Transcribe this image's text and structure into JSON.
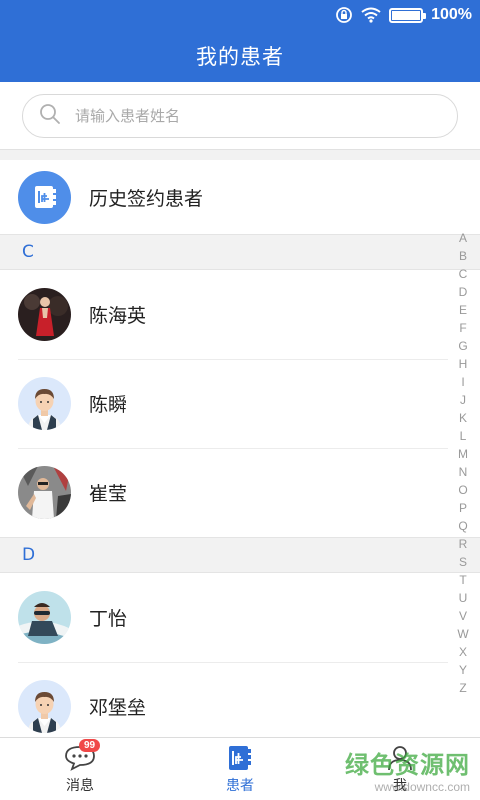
{
  "status_bar": {
    "battery_percent": "100%",
    "battery_level": 1.0,
    "icons": [
      "rotation-lock-icon",
      "wifi-icon",
      "battery-icon"
    ]
  },
  "header": {
    "title": "我的患者"
  },
  "search": {
    "placeholder": "请输入患者姓名",
    "value": ""
  },
  "history": {
    "label": "历史签约患者",
    "icon": "patient-record-icon"
  },
  "sections": [
    {
      "letter": "C",
      "patients": [
        "陈海英",
        "陈瞬",
        "崔莹"
      ]
    },
    {
      "letter": "D",
      "patients": [
        "丁怡",
        "邓堡垒"
      ]
    }
  ],
  "index_letters": [
    "A",
    "B",
    "C",
    "D",
    "E",
    "F",
    "G",
    "H",
    "I",
    "J",
    "K",
    "L",
    "M",
    "N",
    "O",
    "P",
    "Q",
    "R",
    "S",
    "T",
    "U",
    "V",
    "W",
    "X",
    "Y",
    "Z"
  ],
  "tabs": [
    {
      "label": "消息",
      "badge": "99",
      "icon": "chat-bubble-icon",
      "active": false
    },
    {
      "label": "患者",
      "icon": "patient-record-icon",
      "active": true
    },
    {
      "label": "我",
      "icon": "user-icon",
      "active": false
    }
  ],
  "watermark": {
    "main": "绿色资源网",
    "url": "www.downcc.com"
  },
  "colors": {
    "primary": "#2f6fd6",
    "section_letter": "#2f6fd6",
    "badge": "#f04848",
    "history_icon_bg": "#4f8ee9"
  }
}
